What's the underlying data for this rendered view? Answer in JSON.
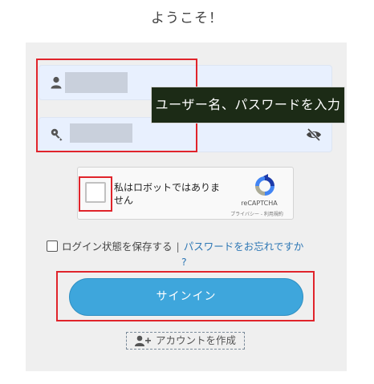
{
  "header": {
    "title": "ようこそ！"
  },
  "login": {
    "username_label": "",
    "password_label": "",
    "tooltip": "ユーザー名、パスワードを入力"
  },
  "captcha": {
    "label": "私はロボットではありません",
    "brand": "reCAPTCHA",
    "links": "プライバシー - 利用規約"
  },
  "remember": {
    "label": "ログイン状態を保存する",
    "separator": "|",
    "forgot_link": "パスワードをお忘れですか",
    "forgot_q": "?"
  },
  "signin": {
    "label": "サインイン"
  },
  "create_account": {
    "label": "アカウントを作成"
  },
  "colors": {
    "accent": "#3ea6dc",
    "highlight": "#e0242b",
    "tooltip_bg": "#1c2b16",
    "field_bg": "#e8f0fe"
  },
  "icons": [
    "user-icon",
    "key-icon",
    "eye-slash-icon",
    "recaptcha-logo-icon",
    "add-person-icon"
  ]
}
